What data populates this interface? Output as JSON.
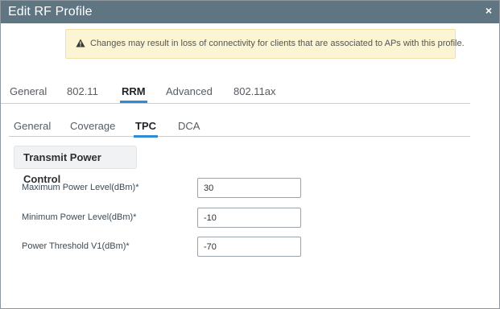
{
  "dialog": {
    "title": "Edit RF Profile",
    "close_glyph": "×",
    "warning_icon": "warning-triangle-icon",
    "warning_text": "Changes may result in loss of connectivity for clients that are associated to APs with this profile."
  },
  "tabs": [
    {
      "label": "General",
      "active": false
    },
    {
      "label": "802.11",
      "active": false
    },
    {
      "label": "RRM",
      "active": true
    },
    {
      "label": "Advanced",
      "active": false
    },
    {
      "label": "802.11ax",
      "active": false
    }
  ],
  "subtabs": [
    {
      "label": "General",
      "active": false
    },
    {
      "label": "Coverage",
      "active": false
    },
    {
      "label": "TPC",
      "active": true
    },
    {
      "label": "DCA",
      "active": false
    }
  ],
  "section": {
    "title": "Transmit Power Control"
  },
  "fields": [
    {
      "label": "Maximum Power Level(dBm)*",
      "value": "30"
    },
    {
      "label": "Minimum Power Level(dBm)*",
      "value": "-10"
    },
    {
      "label": "Power Threshold V1(dBm)*",
      "value": "-70"
    }
  ],
  "colors": {
    "titlebar": "#5f7582",
    "accent": "#2e8bd4",
    "warning_bg": "#fcf5d3",
    "warning_icon": "#3a3a3a"
  }
}
